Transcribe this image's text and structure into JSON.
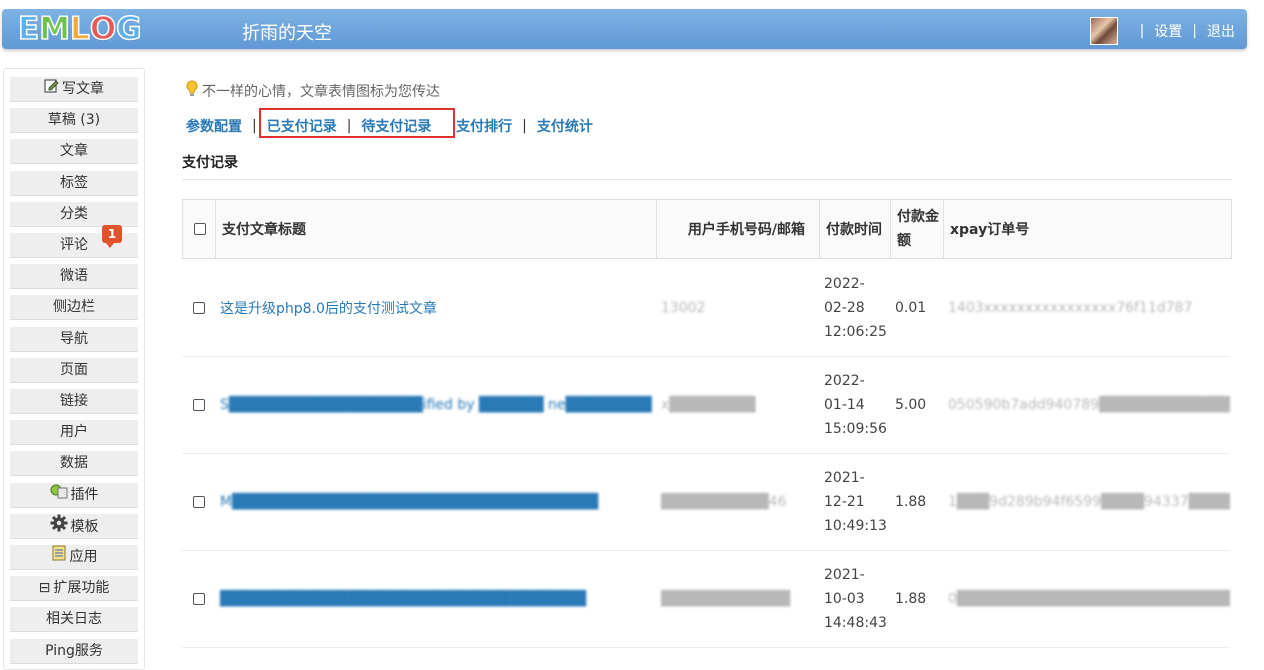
{
  "header": {
    "logo": {
      "letters": [
        "E",
        "M",
        "L",
        "O",
        "G"
      ],
      "colors": [
        "#5db0e8",
        "#6fc24a",
        "#f1a93b",
        "#e85a5a",
        "#5db0e8"
      ]
    },
    "site_title": "折雨的天空",
    "settings_label": "设置",
    "logout_label": "退出",
    "separator": "|"
  },
  "sidebar": {
    "items": [
      {
        "label": "写文章",
        "icon": "edit-icon"
      },
      {
        "label": "草稿 (3)"
      },
      {
        "label": "文章"
      },
      {
        "label": "标签"
      },
      {
        "label": "分类"
      },
      {
        "label": "评论",
        "badge": "1"
      },
      {
        "label": "微语"
      },
      {
        "label": "侧边栏"
      },
      {
        "label": "导航"
      },
      {
        "label": "页面"
      },
      {
        "label": "链接"
      },
      {
        "label": "用户"
      },
      {
        "label": "数据"
      },
      {
        "label": "插件",
        "icon": "plugin-icon"
      },
      {
        "label": "模板",
        "icon": "gear-icon"
      },
      {
        "label": "应用",
        "icon": "app-icon"
      },
      {
        "label": "扩展功能",
        "prefix": "⊟"
      },
      {
        "label": "相关日志"
      },
      {
        "label": "Ping服务"
      }
    ]
  },
  "main": {
    "tip": "不一样的心情，文章表情图标为您传达",
    "tabs": [
      "参数配置",
      "已支付记录",
      "待支付记录",
      "支付排行",
      "支付统计"
    ],
    "separator": "|",
    "section_title": "支付记录",
    "table": {
      "headers": [
        "支付文章标题",
        "用户手机号码/邮箱",
        "付款时间",
        "付款金额",
        "xpay订单号"
      ],
      "rows": [
        {
          "title": "这是升级php8.0后的支付测试文章",
          "contact": "13002",
          "time": [
            "2022-",
            "02-28",
            "12:06:25"
          ],
          "amount": "0.01",
          "order": "1403xxxxxxxxxxxxxxxx76f11d787",
          "title_blurred": false
        },
        {
          "title": "S██████████████████ified by ██████ ne████████",
          "contact": "x████████",
          "time": [
            "2022-",
            "01-14",
            "15:09:56"
          ],
          "amount": "5.00",
          "order": "050590b7add940789██████████████",
          "title_blurred": true
        },
        {
          "title": "M██████████████████████████████████",
          "contact": "██████████46",
          "time": [
            "2021-",
            "12-21",
            "10:49:13"
          ],
          "amount": "1.88",
          "order": "1███9d289b94f6599████94337██████",
          "title_blurred": true
        },
        {
          "title": "██████████████████████████████████",
          "contact": "████████████",
          "time": [
            "2021-",
            "10-03",
            "14:48:43"
          ],
          "amount": "1.88",
          "order": "0███████████████████████████████",
          "title_blurred": true
        }
      ]
    }
  }
}
